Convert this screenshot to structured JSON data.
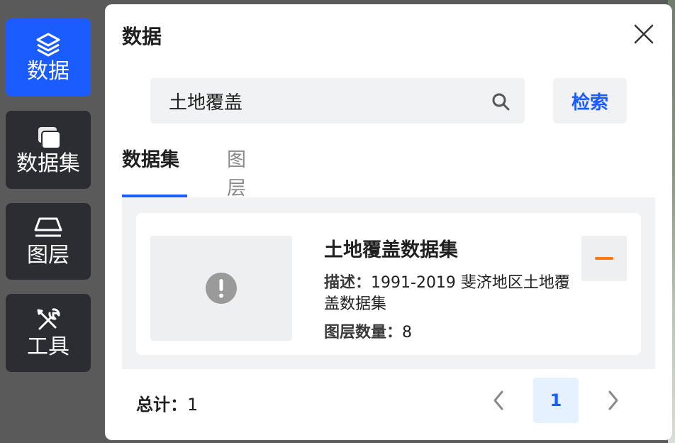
{
  "sidebar": {
    "items": [
      {
        "label": "数据",
        "icon": "layers-icon",
        "active": true
      },
      {
        "label": "数据集",
        "icon": "cards-icon",
        "active": false
      },
      {
        "label": "图层",
        "icon": "layer-plane-icon",
        "active": false
      },
      {
        "label": "工具",
        "icon": "tools-icon",
        "active": false
      }
    ]
  },
  "panel": {
    "title": "数据",
    "search": {
      "value": "土地覆盖",
      "placeholder": "",
      "button_label": "检索"
    },
    "tabs": [
      {
        "label": "数据集",
        "active": true
      },
      {
        "label": "图层",
        "active": false
      }
    ],
    "results": [
      {
        "title": "土地覆盖数据集",
        "desc_key": "描述：",
        "desc_value": "1991-2019 斐济地区土地覆盖数据集",
        "layers_key": "图层数量：",
        "layers_value": "8"
      }
    ],
    "footer": {
      "total_key": "总计：",
      "total_value": "1",
      "current_page": "1"
    }
  },
  "colors": {
    "accent": "#1a5cff",
    "remove": "#ff7a12",
    "sidebar_bg": "#2b2d33",
    "page_active_bg": "#e6f1ff"
  }
}
